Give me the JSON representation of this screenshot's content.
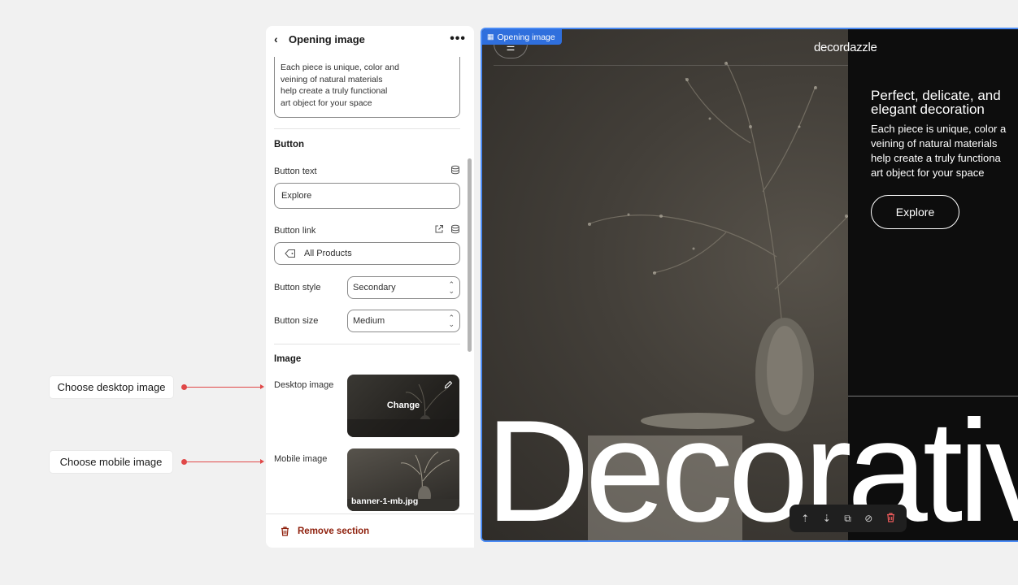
{
  "callouts": {
    "desktop": "Choose desktop image",
    "mobile": "Choose mobile image"
  },
  "panel": {
    "title": "Opening image",
    "description": "Each piece is unique, color and\nveining of natural materials\nhelp create a truly functional\nart object for your space",
    "button_section": "Button",
    "button_text_label": "Button text",
    "button_text_value": "Explore",
    "button_link_label": "Button link",
    "button_link_value": "All Products",
    "button_style_label": "Button style",
    "button_style_value": "Secondary",
    "button_size_label": "Button size",
    "button_size_value": "Medium",
    "image_section": "Image",
    "desktop_image_label": "Desktop image",
    "desktop_image_action": "Change",
    "mobile_image_label": "Mobile image",
    "mobile_image_filename": "banner-1-mb.jpg",
    "remove_label": "Remove section"
  },
  "preview": {
    "badge": "Opening image",
    "logo": "decordazzle",
    "heading": "Perfect, delicate, and elegant decoration",
    "text": "Each piece is unique, color a\nveining of natural materials\nhelp create a truly functiona\nart object for your space",
    "button": "Explore",
    "big_text": "Decorativ"
  },
  "colors": {
    "selection_blue": "#2f6fdd",
    "danger": "#8e1f0b",
    "callout_red": "#e04848"
  }
}
